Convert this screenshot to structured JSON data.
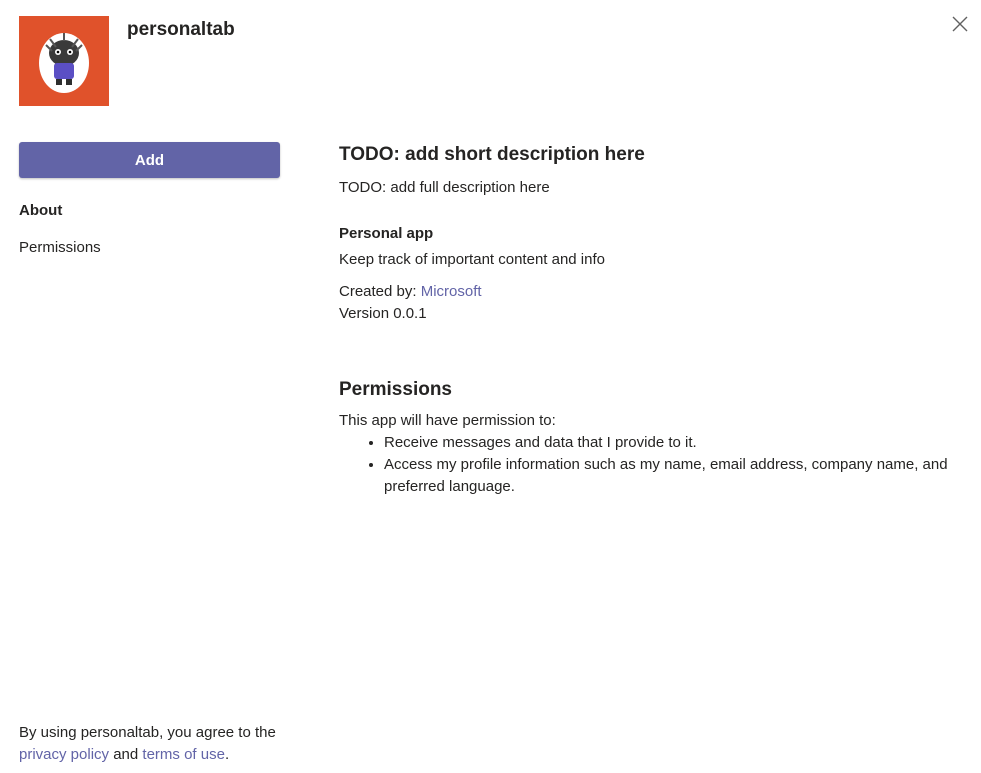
{
  "app": {
    "name": "personaltab",
    "icon": "app-mascot-icon",
    "icon_bg": "#e0522b"
  },
  "header": {
    "close_icon": "close-icon"
  },
  "sidebar": {
    "add_label": "Add",
    "accent_color": "#6264a7",
    "items": [
      {
        "label": "About",
        "active": true
      },
      {
        "label": "Permissions",
        "active": false
      }
    ]
  },
  "main": {
    "short_description": "TODO: add short description here",
    "full_description": "TODO: add full description here",
    "capability": {
      "title": "Personal app",
      "text": "Keep track of important content and info"
    },
    "created_by_label": "Created by:",
    "created_by_value": "Microsoft",
    "version": "Version 0.0.1",
    "permissions": {
      "title": "Permissions",
      "intro": "This app will have permission to:",
      "items": [
        "Receive messages and data that I provide to it.",
        "Access my profile information such as my name, email address, company name, and preferred language."
      ]
    }
  },
  "footer": {
    "prefix": "By using personaltab, you agree to the",
    "privacy_link": "privacy policy",
    "and": "and",
    "terms_link": "terms of use",
    "suffix": "."
  }
}
